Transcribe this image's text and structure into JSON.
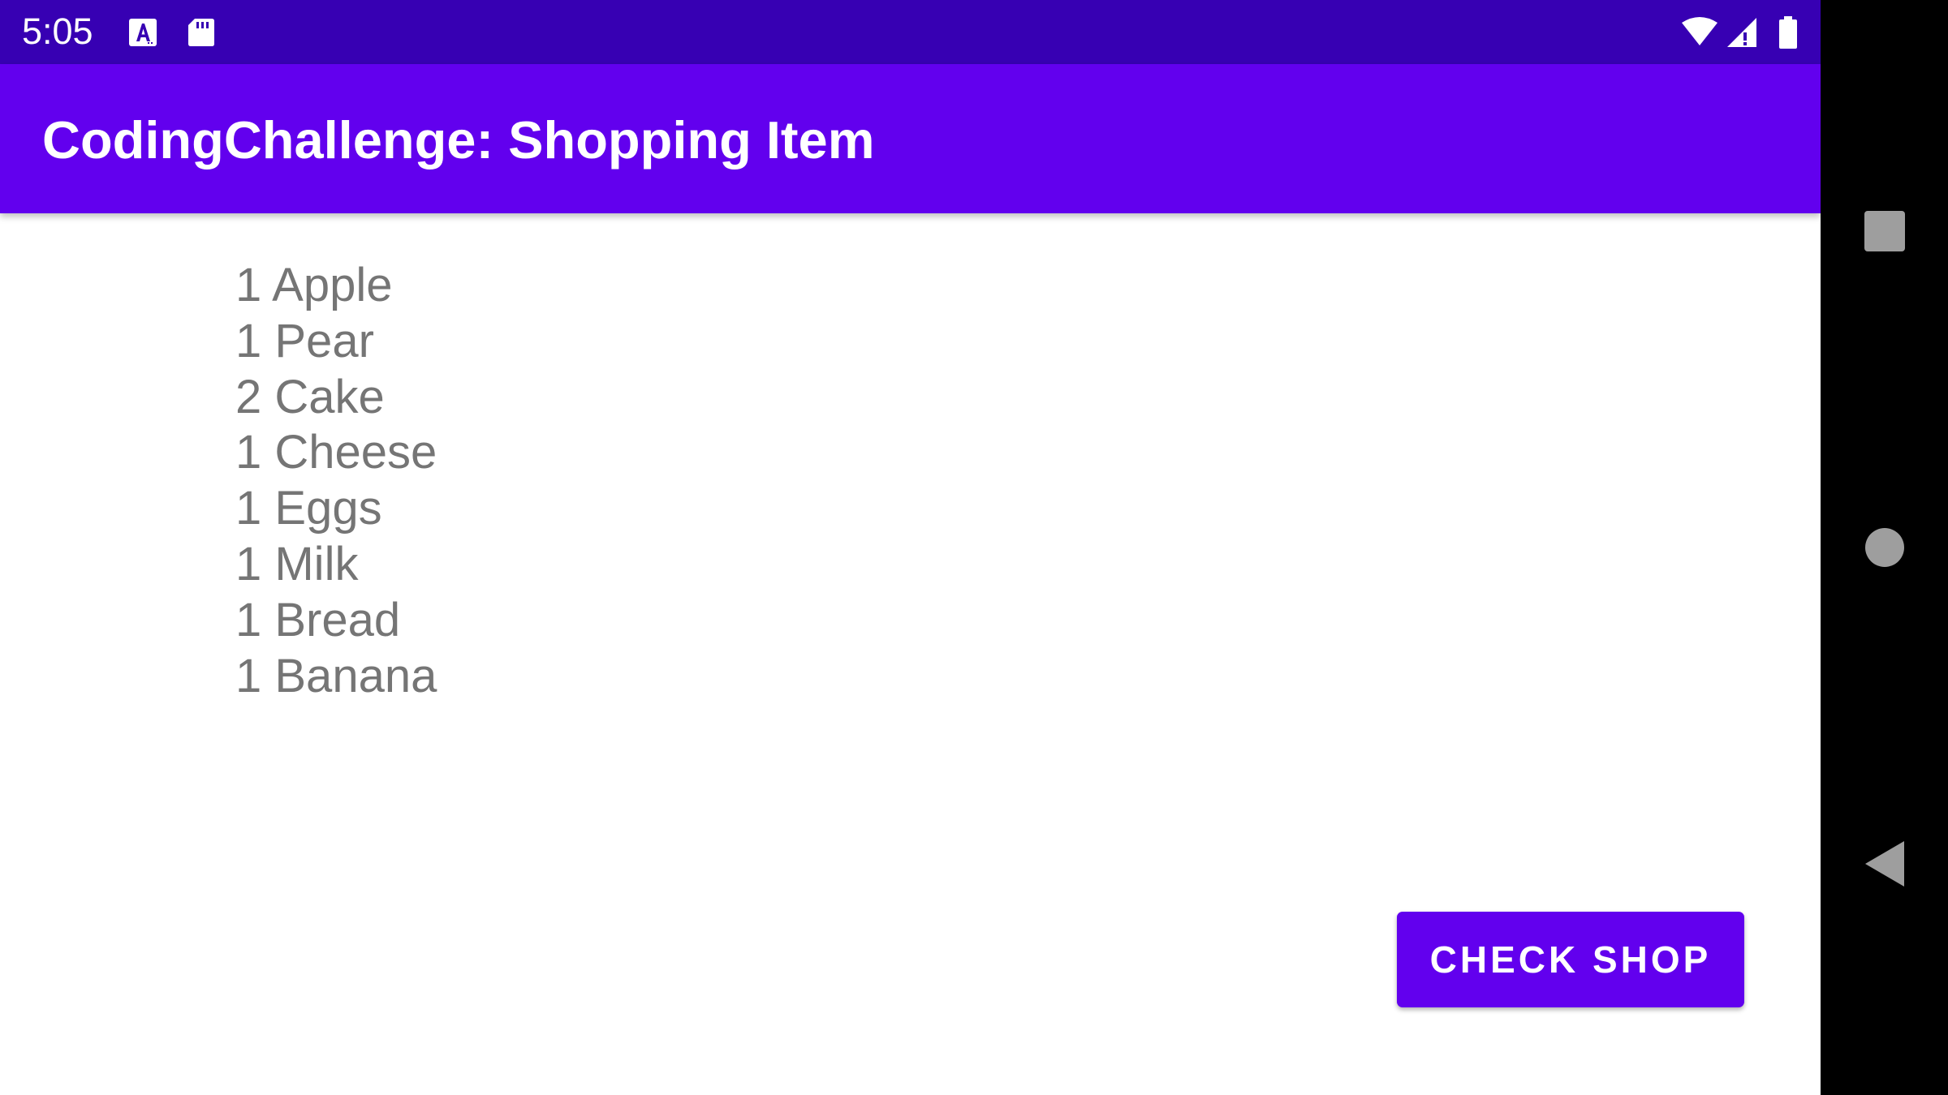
{
  "status_bar": {
    "time": "5:05",
    "left_icons": [
      "text-input-icon",
      "sd-card-icon"
    ],
    "right_icons": [
      "wifi-icon",
      "cell-signal-icon",
      "battery-icon"
    ],
    "color": "#3700b3"
  },
  "app_bar": {
    "title": "CodingChallenge: Shopping Item",
    "color": "#6200ee"
  },
  "shopping_list": {
    "items": [
      "1 Apple",
      "1 Pear",
      "2 Cake",
      "1 Cheese",
      "1 Eggs",
      "1 Milk",
      "1 Bread",
      "1 Banana"
    ],
    "text_color": "#757575"
  },
  "actions": {
    "check_shop_label": "CHECK SHOP",
    "button_color": "#6200ee"
  },
  "navigation_bar": {
    "buttons": [
      "recents-icon",
      "home-icon",
      "back-icon"
    ],
    "icon_color": "#9e9e9e"
  }
}
